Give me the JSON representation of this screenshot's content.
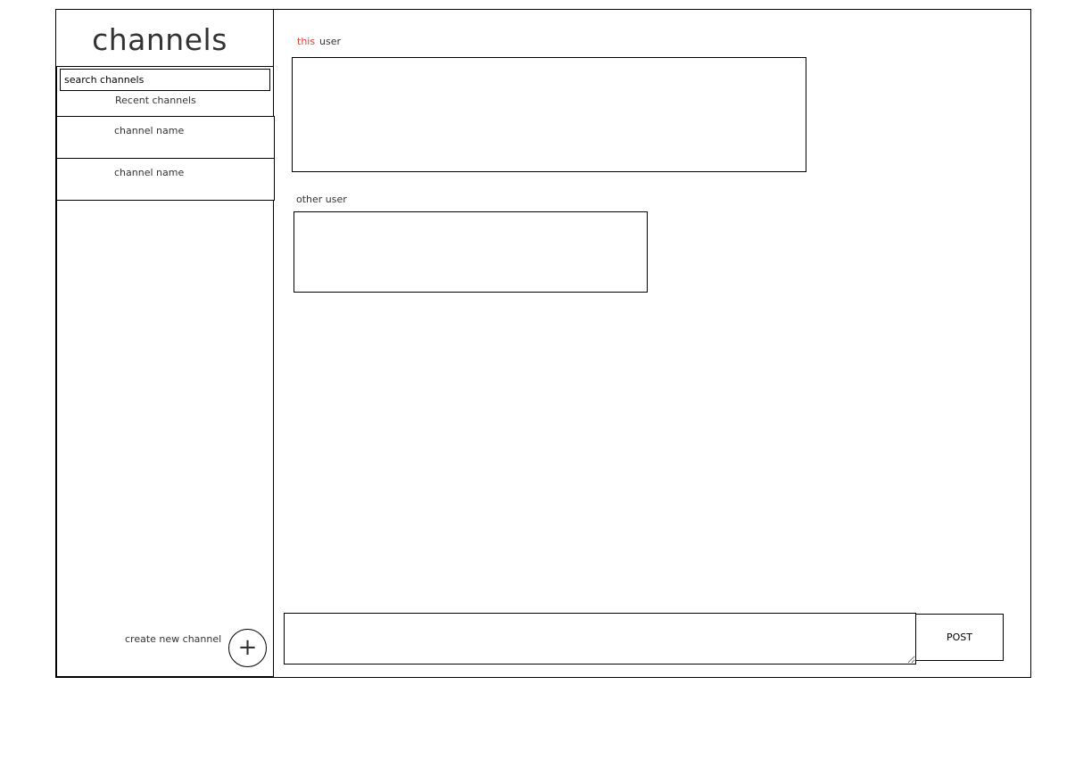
{
  "sidebar": {
    "title": "channels",
    "search": {
      "placeholder": "search channels"
    },
    "recent_label": "Recent channels",
    "channels": [
      {
        "label": "channel name"
      },
      {
        "label": "channel name"
      }
    ],
    "create_label": "create new channel",
    "create_button": {
      "icon": "plus-icon",
      "glyph": "+"
    }
  },
  "messages": [
    {
      "sender_prefix": "this",
      "sender_name": "user",
      "prefix_color": "#d9453a",
      "text": ""
    },
    {
      "sender": "other user",
      "text": ""
    }
  ],
  "composer": {
    "value": "",
    "post_label": "POST"
  }
}
